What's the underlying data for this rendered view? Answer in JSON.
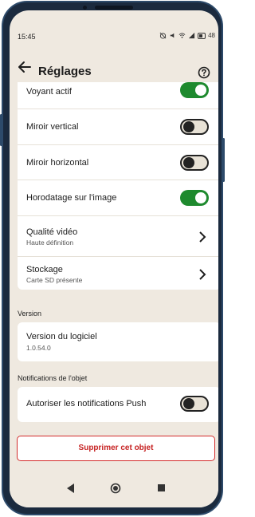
{
  "status_bar": {
    "time": "15:45",
    "battery": "48"
  },
  "header": {
    "title": "Réglages",
    "back_icon": "arrow-left-icon",
    "help_icon": "help-circle-icon"
  },
  "settings_card": {
    "items": [
      {
        "label": "Voyant actif",
        "toggle": "on"
      },
      {
        "label": "Miroir vertical",
        "toggle": "off"
      },
      {
        "label": "Miroir horizontal",
        "toggle": "off"
      },
      {
        "label": "Horodatage sur l'image",
        "toggle": "on"
      },
      {
        "label": "Qualité vidéo",
        "sub": "Haute définition"
      },
      {
        "label": "Stockage",
        "sub": "Carte SD présente"
      }
    ]
  },
  "version_section": {
    "label": "Version",
    "item_label": "Version du logiciel",
    "item_value": "1.0.54.0"
  },
  "notifications_section": {
    "label": "Notifications de l'objet",
    "item_label": "Autoriser les notifications Push",
    "toggle": "off"
  },
  "delete_button": {
    "label": "Supprimer cet objet"
  },
  "colors": {
    "background": "#efe9e0",
    "toggle_on": "#1e8a2e",
    "danger": "#c62121"
  }
}
